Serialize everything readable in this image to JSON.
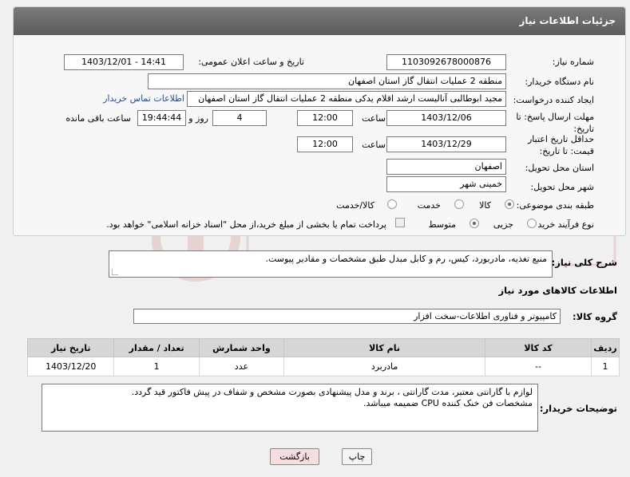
{
  "header": {
    "title": "جزئیات اطلاعات نیاز"
  },
  "fields": {
    "need_number_label": "شماره نیاز:",
    "need_number": "1103092678000876",
    "announce_label": "تاریخ و ساعت اعلان عمومی:",
    "announce_value": "1403/12/01 - 14:41",
    "buyer_org_label": "نام دستگاه خریدار:",
    "buyer_org": "منطقه 2 عملیات انتقال گاز استان اصفهان",
    "creator_label": "ایجاد کننده درخواست:",
    "creator": "مجید ابوطالبی آنالیست ارشد اقلام یدکی منطقه 2 عملیات انتقال گاز استان اصفهان",
    "contact_link": "اطلاعات تماس خریدار",
    "reply_deadline_label": "مهلت ارسال پاسخ: تا تاریخ:",
    "reply_date": "1403/12/06",
    "time_label": "ساعت",
    "reply_time": "12:00",
    "days_value": "4",
    "days_label": "روز و",
    "remaining_time": "19:44:44",
    "remaining_label": "ساعت باقی مانده",
    "price_deadline_label": "حداقل تاریخ اعتبار قیمت: تا تاریخ:",
    "price_date": "1403/12/29",
    "price_time": "12:00",
    "province_label": "استان محل تحویل:",
    "province": "اصفهان",
    "city_label": "شهر محل تحویل:",
    "city": "خمینی شهر",
    "category_label": "طبقه بندی موضوعی:",
    "category_options": [
      "کالا",
      "خدمت",
      "کالا/خدمت"
    ],
    "process_label": "نوع فرآیند خرید :",
    "process_options": [
      "جزیی",
      "متوسط"
    ],
    "payment_note": "پرداخت تمام یا بخشی از مبلغ خرید،از محل \"اسناد خزانه اسلامی\" خواهد بود."
  },
  "summary": {
    "label": "شرح کلی نیاز:",
    "text": "منبع تغذیه، مادربورد، کیس، رم و کابل مبدل طبق مشخصات و مقادیر پیوست."
  },
  "goods": {
    "section_title": "اطلاعات کالاهای مورد نیاز",
    "group_label": "گروه کالا:",
    "group_value": "کامپیوتر و فناوری اطلاعات-سخت افزار",
    "columns": [
      "ردیف",
      "کد کالا",
      "نام کالا",
      "واحد شمارش",
      "تعداد / مقدار",
      "تاریخ نیاز"
    ],
    "rows": [
      {
        "index": "1",
        "code": "--",
        "name": "مادربرد",
        "unit": "عدد",
        "qty": "1",
        "date": "1403/12/20"
      }
    ]
  },
  "buyer_notes": {
    "label": "توضیحات خریدار:",
    "line1": "لوازم با گارانتی معتبر، مدت گارانتی ، برند و مدل پیشنهادی بصورت مشخص و شفاف در پیش فاکتور قید گردد.",
    "line2": "مشخصات فن خنک کننده CPU ضمیمه میباشد."
  },
  "buttons": {
    "print": "چاپ",
    "back": "بازگشت"
  },
  "colors": {
    "header": "#666666",
    "link": "#1f4fa0",
    "back_button": "#f7dede"
  }
}
